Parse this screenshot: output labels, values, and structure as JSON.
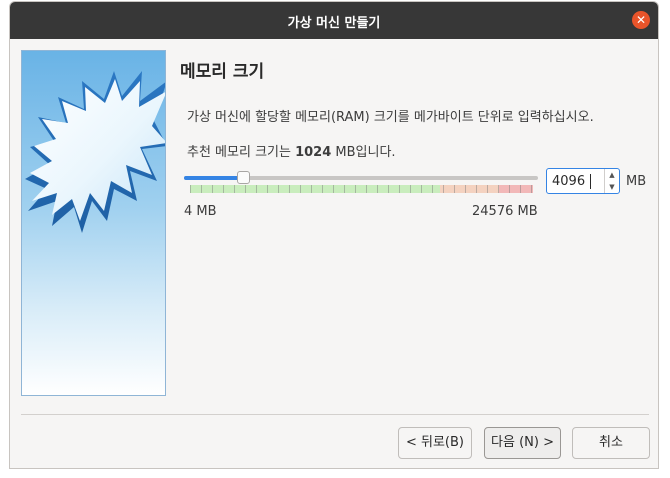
{
  "window": {
    "title": "가상 머신 만들기",
    "close_glyph": "✕"
  },
  "page": {
    "heading": "메모리 크기",
    "description": "가상 머신에 할당할 메모리(RAM) 크기를 메가바이트 단위로 입력하십시오.",
    "recommend_prefix": "추천 메모리 크기는 ",
    "recommend_value": "1024",
    "recommend_suffix": " MB입니다."
  },
  "memory": {
    "value": "4096",
    "unit": "MB",
    "min_label": "4 MB",
    "max_label": "24576 MB",
    "slider_fraction": 0.1667
  },
  "buttons": {
    "back": "< 뒤로(B)",
    "next": "다음 (N) >",
    "cancel": "취소"
  },
  "colors": {
    "titlebar": "#373737",
    "close": "#e9542a",
    "accent": "#3584e4",
    "scale_green": "#c9edbd",
    "scale_orange": "#f4d2c0",
    "scale_red": "#f2b8b8"
  }
}
